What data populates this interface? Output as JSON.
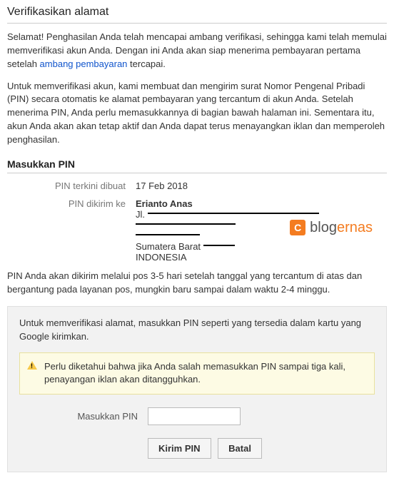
{
  "title": "Verifikasikan alamat",
  "intro_part1": "Selamat! Penghasilan Anda telah mencapai ambang verifikasi, sehingga kami telah memulai memverifikasi akun Anda. Dengan ini Anda akan siap menerima pembayaran pertama setelah ",
  "intro_link": "ambang pembayaran",
  "intro_part2": " tercapai.",
  "para2": "Untuk memverifikasi akun, kami membuat dan mengirim surat Nomor Pengenal Pribadi (PIN) secara otomatis ke alamat pembayaran yang tercantum di akun Anda. Setelah menerima PIN, Anda perlu memasukkannya di bagian   bawah halaman ini. Sementara itu, akun Anda akan akan tetap aktif dan Anda dapat terus menayangkan iklan dan memperoleh penghasilan.",
  "section_title": "Masukkan PIN",
  "row1_label": "PIN terkini dibuat",
  "row1_value": "17 Feb 2018",
  "row2_label": "PIN dikirim ke",
  "address": {
    "name": "Erianto Anas",
    "line1_prefix": "Jl. ",
    "region": "Sumatera Barat ",
    "country": "INDONESIA"
  },
  "watermark": {
    "logo_letter": "C",
    "text_plain": "blog",
    "text_accent": "ernas"
  },
  "para3": "PIN Anda akan dikirim melalui pos 3-5 hari setelah tanggal yang tercantum di atas dan bergantung pada layanan pos, mungkin baru sampai dalam waktu 2-4 minggu.",
  "form": {
    "instruction": "Untuk memverifikasi alamat, masukkan PIN seperti yang tersedia dalam kartu yang Google kirimkan.",
    "warning": "Perlu diketahui bahwa jika Anda salah memasukkan PIN sampai tiga kali, penayangan iklan akan ditangguhkan.",
    "input_label": "Masukkan PIN",
    "input_value": "",
    "submit_label": "Kirim PIN",
    "cancel_label": "Batal"
  }
}
